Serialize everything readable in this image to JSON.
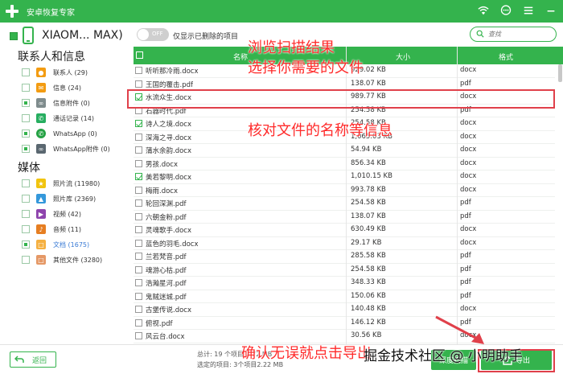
{
  "app": {
    "title": "安卓恢复专家"
  },
  "titlebar_icons": [
    "wifi-icon",
    "chat-icon",
    "menu-icon",
    "minimize-icon"
  ],
  "device": {
    "name": "XIAOM... MAX)",
    "toggle_state": "OFF",
    "toggle_label": "仅显示已删除的项目"
  },
  "search": {
    "placeholder": "查找"
  },
  "sidebar": {
    "sections": [
      {
        "title": "联系人和信息",
        "items": [
          {
            "label": "联系人 (29)",
            "icon": "contacts-icon",
            "color": "#f39c12"
          },
          {
            "label": "信息 (24)",
            "icon": "message-icon",
            "color": "#f39c12"
          },
          {
            "label": "信息附件 (0)",
            "icon": "attachment-icon",
            "color": "#7f8c8d"
          },
          {
            "label": "通话记录 (14)",
            "icon": "call-log-icon",
            "color": "#27ae60"
          },
          {
            "label": "WhatsApp (0)",
            "icon": "whatsapp-icon",
            "color": "#25a244"
          },
          {
            "label": "WhatsApp附件 (0)",
            "icon": "whatsapp-attachment-icon",
            "color": "#5a6770"
          }
        ]
      },
      {
        "title": "媒体",
        "items": [
          {
            "label": "照片流 (11980)",
            "icon": "photo-stream-icon",
            "color": "#f1c40f"
          },
          {
            "label": "照片库 (2369)",
            "icon": "photo-library-icon",
            "color": "#3498db"
          },
          {
            "label": "视频 (42)",
            "icon": "video-icon",
            "color": "#8e44ad"
          },
          {
            "label": "音频 (11)",
            "icon": "audio-icon",
            "color": "#e67e22"
          },
          {
            "label": "文档 (1675)",
            "icon": "document-icon",
            "color": "#f5b041"
          },
          {
            "label": "其他文件 (3280)",
            "icon": "other-files-icon",
            "color": "#e59866"
          }
        ]
      }
    ]
  },
  "table": {
    "headers": {
      "name": "名称",
      "size": "大小",
      "format": "格式"
    },
    "rows": [
      {
        "name": "听听那冷雨.docx",
        "size": "929.02 KB",
        "format": "docx",
        "checked": false
      },
      {
        "name": "王国的覆击.pdf",
        "size": "138.07 KB",
        "format": "pdf",
        "checked": false
      },
      {
        "name": "水流众生.docx",
        "size": "989.77 KB",
        "format": "docx",
        "checked": true
      },
      {
        "name": "石器时代.pdf",
        "size": "254.58 KB",
        "format": "pdf",
        "checked": false
      },
      {
        "name": "诗人之境.docx",
        "size": "254.58 KB",
        "format": "docx",
        "checked": true
      },
      {
        "name": "深海之寻.docx",
        "size": "1,065.03 KB",
        "format": "docx",
        "checked": false
      },
      {
        "name": "蒲水余韵.docx",
        "size": "54.94 KB",
        "format": "docx",
        "checked": false
      },
      {
        "name": "男孩.docx",
        "size": "856.34 KB",
        "format": "docx",
        "checked": false
      },
      {
        "name": "美若黎明.docx",
        "size": "1,010.15 KB",
        "format": "docx",
        "checked": true
      },
      {
        "name": "梅雨.docx",
        "size": "993.78 KB",
        "format": "docx",
        "checked": false
      },
      {
        "name": "轮回深渊.pdf",
        "size": "254.58 KB",
        "format": "pdf",
        "checked": false
      },
      {
        "name": "六朝金粉.pdf",
        "size": "138.07 KB",
        "format": "pdf",
        "checked": false
      },
      {
        "name": "灵魂歌手.docx",
        "size": "630.49 KB",
        "format": "docx",
        "checked": false
      },
      {
        "name": "蓝色的羽毛.docx",
        "size": "29.17 KB",
        "format": "docx",
        "checked": false
      },
      {
        "name": "兰若梵音.pdf",
        "size": "285.58 KB",
        "format": "pdf",
        "checked": false
      },
      {
        "name": "魂游心枯.pdf",
        "size": "254.58 KB",
        "format": "pdf",
        "checked": false
      },
      {
        "name": "浩瀚星河.pdf",
        "size": "348.33 KB",
        "format": "pdf",
        "checked": false
      },
      {
        "name": "鬼贼迷城.pdf",
        "size": "150.06 KB",
        "format": "pdf",
        "checked": false
      },
      {
        "name": "古堡传说.docx",
        "size": "140.48 KB",
        "format": "docx",
        "checked": false
      },
      {
        "name": "俯视.pdf",
        "size": "146.12 KB",
        "format": "pdf",
        "checked": false
      },
      {
        "name": "风云台.docx",
        "size": "30.56 KB",
        "format": "docx",
        "checked": false
      }
    ]
  },
  "annotations": {
    "top": "浏览扫描结果",
    "top2": "选择你需要的文件",
    "middle": "核对文件的名称等信息",
    "bottom": "确认无误就点击导出",
    "watermark": "掘金技术社区 @ 小明助手"
  },
  "footer": {
    "back_label": "返回",
    "total": "总计: 19 个项目 2.72 MB",
    "selected": "选定的项目: 3个项目2.22 MB",
    "deep_scan_label": "深度扫描",
    "export_label": "导出"
  },
  "colors": {
    "accent": "#34b34d",
    "highlight": "#e0404a",
    "caption": "#ff2a2a"
  }
}
